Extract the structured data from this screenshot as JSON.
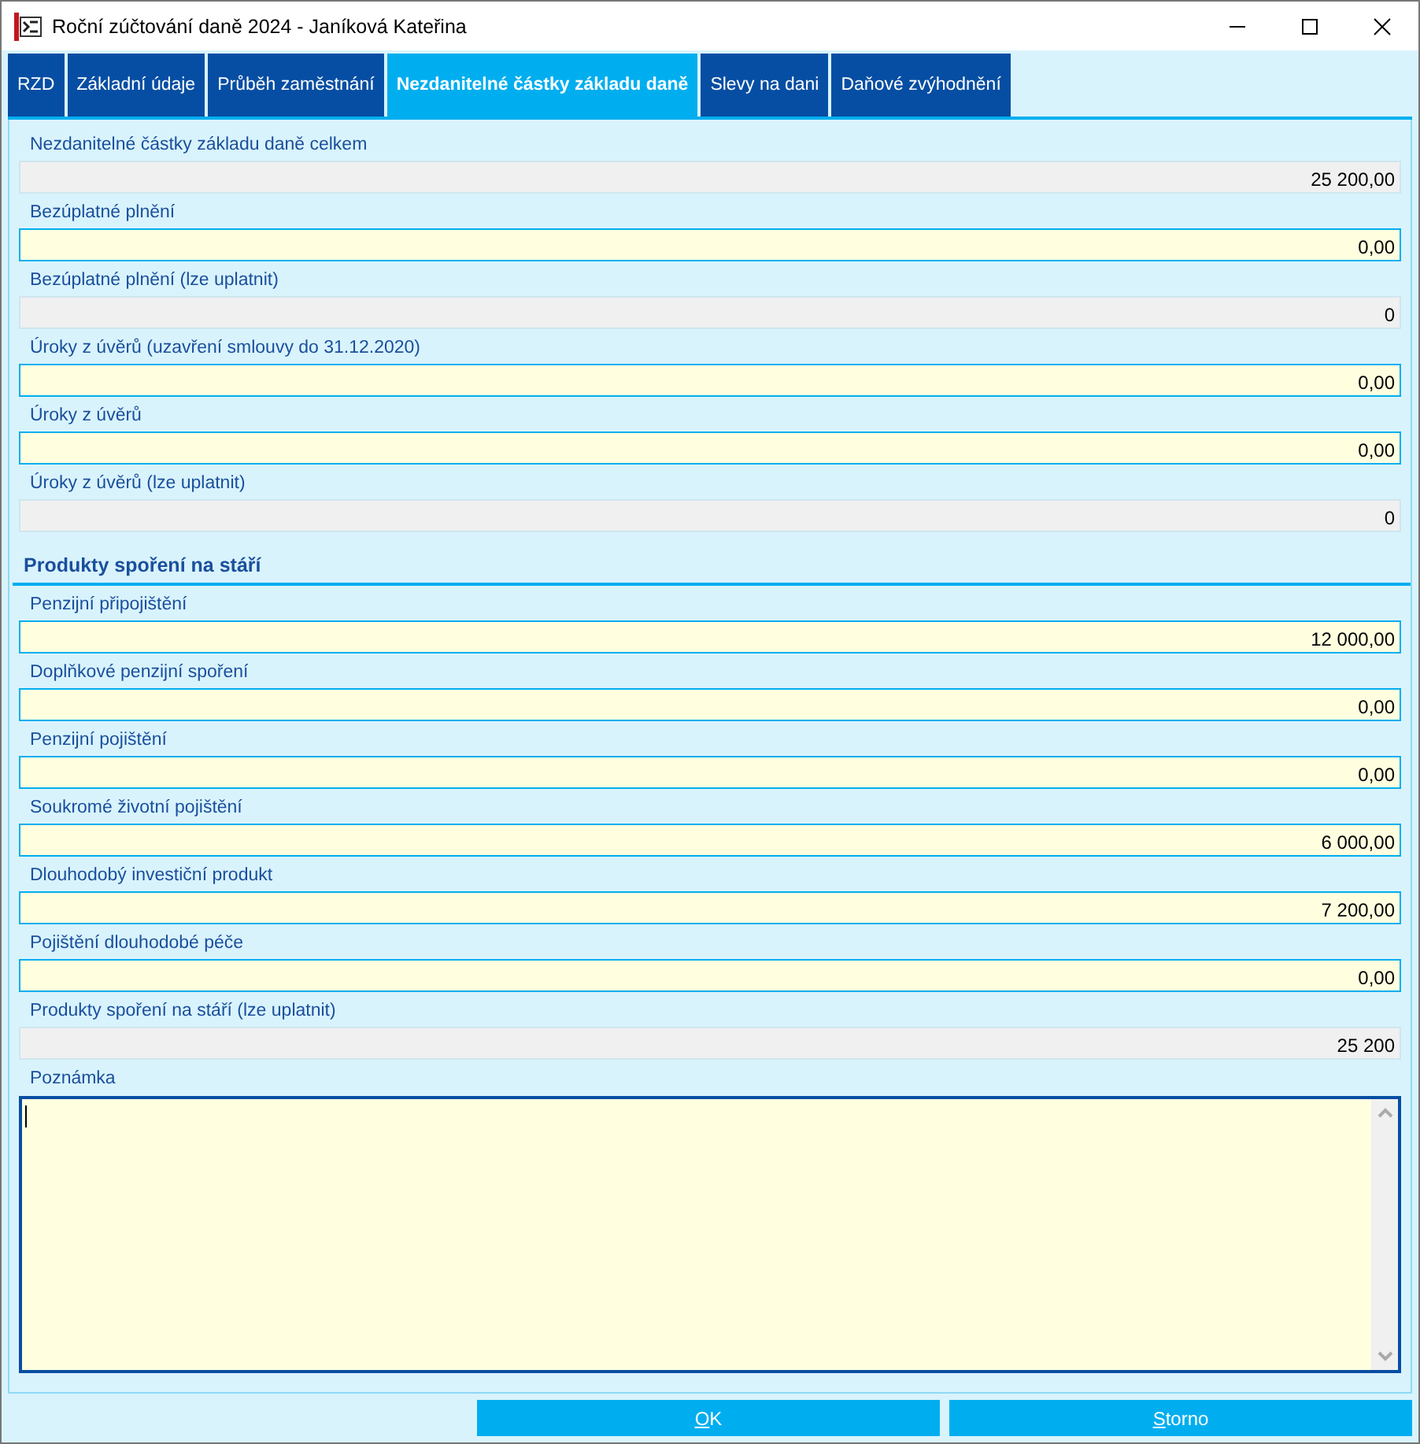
{
  "window": {
    "title": "Roční zúčtování daně 2024 - Janíková Kateřina"
  },
  "tabs": [
    {
      "label": "RZD",
      "selected": false
    },
    {
      "label": "Základní údaje",
      "selected": false
    },
    {
      "label": "Průběh zaměstnání",
      "selected": false
    },
    {
      "label": "Nezdanitelné částky základu daně",
      "selected": true
    },
    {
      "label": "Slevy na dani",
      "selected": false
    },
    {
      "label": "Daňové zvýhodnění",
      "selected": false
    }
  ],
  "items": [
    {
      "kind": "field",
      "label": "Nezdanitelné částky základu daně celkem",
      "value": "25 200,00",
      "readonly": true
    },
    {
      "kind": "field",
      "label": "Bezúplatné plnění",
      "value": "0,00",
      "readonly": false
    },
    {
      "kind": "field",
      "label": "Bezúplatné plnění (lze uplatnit)",
      "value": "0",
      "readonly": true
    },
    {
      "kind": "field",
      "label": "Úroky z úvěrů (uzavření smlouvy do 31.12.2020)",
      "value": "0,00",
      "readonly": false
    },
    {
      "kind": "field",
      "label": "Úroky z úvěrů",
      "value": "0,00",
      "readonly": false
    },
    {
      "kind": "field",
      "label": "Úroky z úvěrů (lze uplatnit)",
      "value": "0",
      "readonly": true
    },
    {
      "kind": "section",
      "label": "Produkty spoření na stáří"
    },
    {
      "kind": "field",
      "label": "Penzijní připojištění",
      "value": "12 000,00",
      "readonly": false
    },
    {
      "kind": "field",
      "label": "Doplňkové penzijní spoření",
      "value": "0,00",
      "readonly": false
    },
    {
      "kind": "field",
      "label": "Penzijní pojištění",
      "value": "0,00",
      "readonly": false
    },
    {
      "kind": "field",
      "label": "Soukromé životní pojištění",
      "value": "6 000,00",
      "readonly": false
    },
    {
      "kind": "field",
      "label": "Dlouhodobý investiční produkt",
      "value": "7 200,00",
      "readonly": false
    },
    {
      "kind": "field",
      "label": "Pojištění dlouhodobé péče",
      "value": "0,00",
      "readonly": false
    },
    {
      "kind": "field",
      "label": "Produkty spoření na stáří (lze uplatnit)",
      "value": "25 200",
      "readonly": true
    }
  ],
  "note": {
    "label": "Poznámka"
  },
  "buttons": [
    "OK",
    "Storno"
  ]
}
